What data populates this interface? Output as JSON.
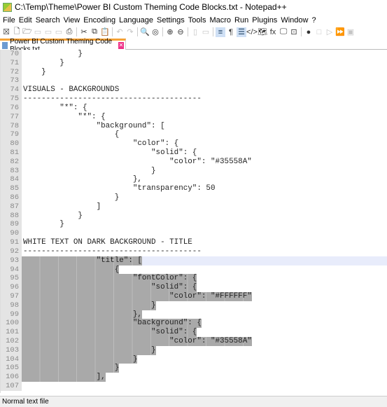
{
  "window": {
    "title": "C:\\Temp\\Theme\\Power BI Custom Theming Code Blocks.txt - Notepad++"
  },
  "menu": [
    "File",
    "Edit",
    "Search",
    "View",
    "Encoding",
    "Language",
    "Settings",
    "Tools",
    "Macro",
    "Run",
    "Plugins",
    "Window",
    "?"
  ],
  "toolbar": [
    {
      "icon": "close-all-icon",
      "glyph": "☒"
    },
    {
      "icon": "new-file-icon",
      "glyph": "🗋"
    },
    {
      "icon": "open-icon",
      "glyph": "🗁"
    },
    {
      "icon": "save-icon",
      "glyph": "▭",
      "disabled": true
    },
    {
      "icon": "save-all-icon",
      "glyph": "▭",
      "disabled": true
    },
    {
      "icon": "close-icon",
      "glyph": "▭",
      "disabled": true
    },
    {
      "icon": "print-icon",
      "glyph": "⎙"
    },
    {
      "sep": true
    },
    {
      "icon": "cut-icon",
      "glyph": "✂"
    },
    {
      "icon": "copy-icon",
      "glyph": "⧉"
    },
    {
      "icon": "paste-icon",
      "glyph": "📋"
    },
    {
      "sep": true
    },
    {
      "icon": "undo-icon",
      "glyph": "↶",
      "disabled": true
    },
    {
      "icon": "redo-icon",
      "glyph": "↷",
      "disabled": true
    },
    {
      "sep": true
    },
    {
      "icon": "find-icon",
      "glyph": "🔍"
    },
    {
      "icon": "replace-icon",
      "glyph": "◎"
    },
    {
      "sep": true
    },
    {
      "icon": "zoom-in-icon",
      "glyph": "⊕"
    },
    {
      "icon": "zoom-out-icon",
      "glyph": "⊖"
    },
    {
      "sep": true
    },
    {
      "icon": "sync-vertical-icon",
      "glyph": "▯",
      "disabled": true
    },
    {
      "icon": "sync-horizontal-icon",
      "glyph": "▭",
      "disabled": true
    },
    {
      "sep": true
    },
    {
      "icon": "word-wrap-icon",
      "glyph": "≡",
      "active": true
    },
    {
      "icon": "show-all-chars-icon",
      "glyph": "¶"
    },
    {
      "icon": "indent-guide-icon",
      "glyph": "☰",
      "active": true
    },
    {
      "icon": "xml-icon",
      "glyph": "</>"
    },
    {
      "icon": "doc-map-icon",
      "glyph": "🗺"
    },
    {
      "icon": "function-list-icon",
      "glyph": "fx"
    },
    {
      "icon": "monitor-icon",
      "glyph": "🖵"
    },
    {
      "icon": "folder-workspace-icon",
      "glyph": "⊡"
    },
    {
      "sep": true
    },
    {
      "icon": "record-macro-icon",
      "glyph": "●"
    },
    {
      "icon": "stop-macro-icon",
      "glyph": "□",
      "disabled": true
    },
    {
      "icon": "play-macro-icon",
      "glyph": "▷",
      "disabled": true
    },
    {
      "icon": "run-macro-multiple-icon",
      "glyph": "⏩"
    },
    {
      "icon": "save-macro-icon",
      "glyph": "▣",
      "disabled": true
    }
  ],
  "tab": {
    "label": "Power BI Custom Theming Code Blocks.txt"
  },
  "editor": {
    "lines": [
      {
        "n": "70",
        "t": "            }"
      },
      {
        "n": "71",
        "t": "        }"
      },
      {
        "n": "72",
        "t": "    }"
      },
      {
        "n": "73",
        "t": ""
      },
      {
        "n": "74",
        "t": "VISUALS - BACKGROUNDS"
      },
      {
        "n": "75",
        "t": "---------------------------------------"
      },
      {
        "n": "76",
        "t": "        \"*\": {"
      },
      {
        "n": "77",
        "t": "            \"*\": {"
      },
      {
        "n": "78",
        "t": "                \"background\": ["
      },
      {
        "n": "79",
        "t": "                    {"
      },
      {
        "n": "80",
        "t": "                        \"color\": {"
      },
      {
        "n": "81",
        "t": "                            \"solid\": {"
      },
      {
        "n": "82",
        "t": "                                \"color\": \"#35558A\""
      },
      {
        "n": "83",
        "t": "                            }"
      },
      {
        "n": "84",
        "t": "                        },"
      },
      {
        "n": "85",
        "t": "                        \"transparency\": 50"
      },
      {
        "n": "86",
        "t": "                    }"
      },
      {
        "n": "87",
        "t": "                ]"
      },
      {
        "n": "88",
        "t": "            }"
      },
      {
        "n": "89",
        "t": "        }"
      },
      {
        "n": "90",
        "t": ""
      },
      {
        "n": "91",
        "t": "WHITE TEXT ON DARK BACKGROUND - TITLE"
      },
      {
        "n": "92",
        "t": "---------------------------------------"
      },
      {
        "n": "93",
        "t": "                \"title\": [",
        "sel": true,
        "cur": true
      },
      {
        "n": "94",
        "t": "                    {",
        "sel": true
      },
      {
        "n": "95",
        "t": "                        \"fontColor\": {",
        "sel": true
      },
      {
        "n": "96",
        "t": "                            \"solid\": {",
        "sel": true
      },
      {
        "n": "97",
        "t": "                                \"color\": \"#FFFFFF\"",
        "sel": true
      },
      {
        "n": "98",
        "t": "                            }",
        "sel": true
      },
      {
        "n": "99",
        "t": "                        },",
        "sel": true
      },
      {
        "n": "100",
        "t": "                        \"background\": {",
        "sel": true
      },
      {
        "n": "101",
        "t": "                            \"solid\": {",
        "sel": true
      },
      {
        "n": "102",
        "t": "                                \"color\": \"#35558A\"",
        "sel": true
      },
      {
        "n": "103",
        "t": "                            }",
        "sel": true
      },
      {
        "n": "104",
        "t": "                        }",
        "sel": true
      },
      {
        "n": "105",
        "t": "                    }",
        "sel": true
      },
      {
        "n": "106",
        "t": "                ],",
        "sel": true
      },
      {
        "n": "107",
        "t": ""
      }
    ]
  },
  "status": {
    "text": "Normal text file"
  }
}
